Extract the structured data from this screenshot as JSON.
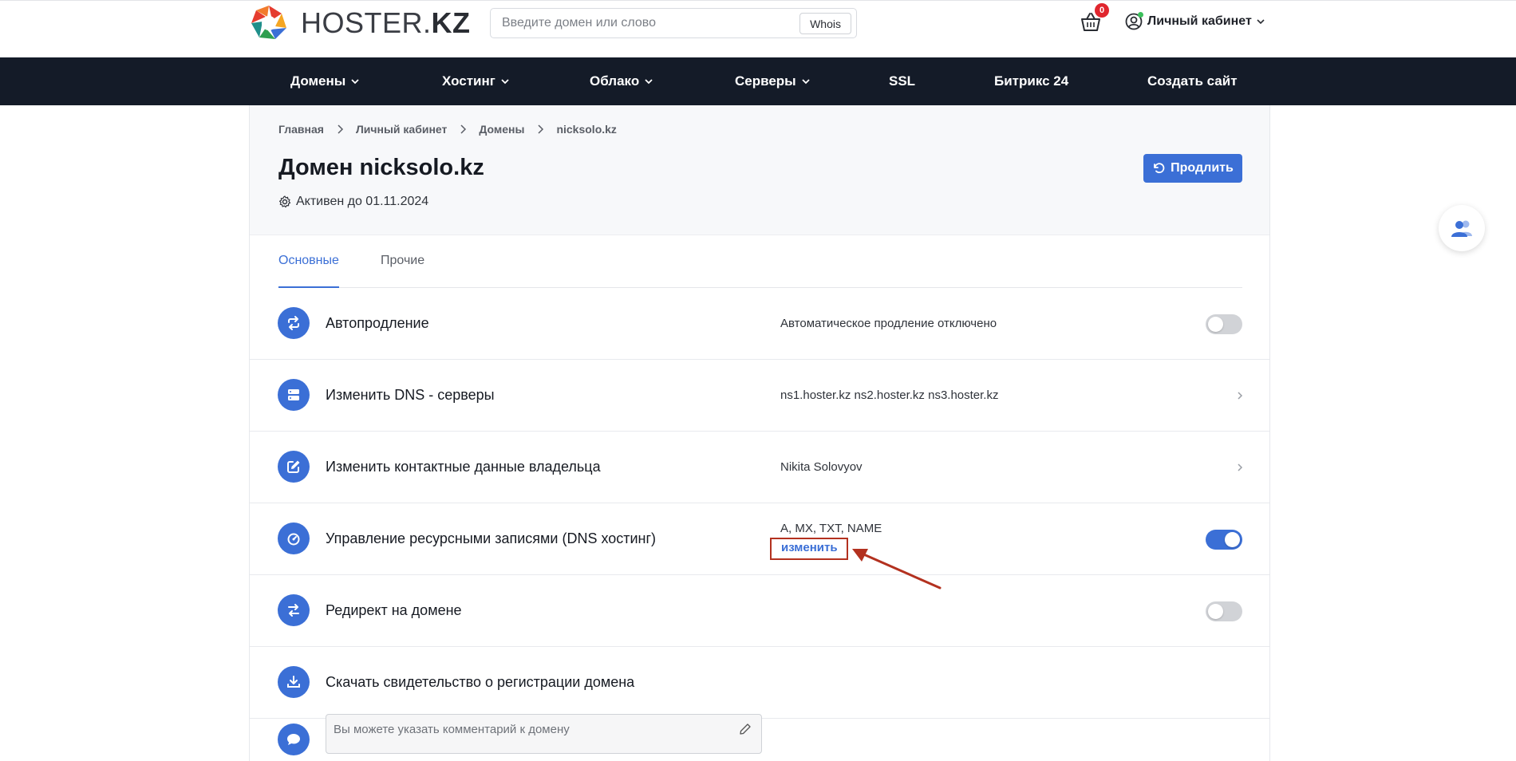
{
  "header": {
    "logo_main": "HOSTER.",
    "logo_bold": "KZ",
    "search_placeholder": "Введите домен или слово",
    "whois_label": "Whois",
    "cart_count": "0",
    "account_label": "Личный кабинет"
  },
  "nav": {
    "items": [
      {
        "label": "Домены",
        "dropdown": true
      },
      {
        "label": "Хостинг",
        "dropdown": true
      },
      {
        "label": "Облако",
        "dropdown": true
      },
      {
        "label": "Серверы",
        "dropdown": true
      },
      {
        "label": "SSL",
        "dropdown": false
      },
      {
        "label": "Битрикс 24",
        "dropdown": false
      },
      {
        "label": "Создать сайт",
        "dropdown": false
      }
    ]
  },
  "breadcrumb": [
    "Главная",
    "Личный кабинет",
    "Домены",
    "nicksolo.kz"
  ],
  "page": {
    "title": "Домен nicksolo.kz",
    "status": "Активен до 01.11.2024",
    "renew_label": "Продлить"
  },
  "tabs": [
    "Основные",
    "Прочие"
  ],
  "rows": {
    "autorenew": {
      "label": "Автопродление",
      "value": "Автоматическое продление отключено",
      "toggle": false
    },
    "dns_servers": {
      "label": "Изменить DNS - серверы",
      "value": "ns1.hoster.kz ns2.hoster.kz ns3.hoster.kz"
    },
    "contacts": {
      "label": "Изменить контактные данные владельца",
      "value": "Nikita Solovyov"
    },
    "dns_hosting": {
      "label": "Управление ресурсными записями (DNS хостинг)",
      "value": "A, MX, TXT, NAME",
      "edit_label": "изменить",
      "toggle": true
    },
    "redirect": {
      "label": "Редирект на домене",
      "toggle": false
    },
    "certificate": {
      "label": "Скачать свидетельство о регистрации домена"
    }
  },
  "comment": {
    "placeholder": "Вы можете указать комментарий к домену"
  },
  "colors": {
    "accent": "#3b6fd6",
    "nav_bg": "#141b28",
    "annotation": "#b3311f"
  }
}
